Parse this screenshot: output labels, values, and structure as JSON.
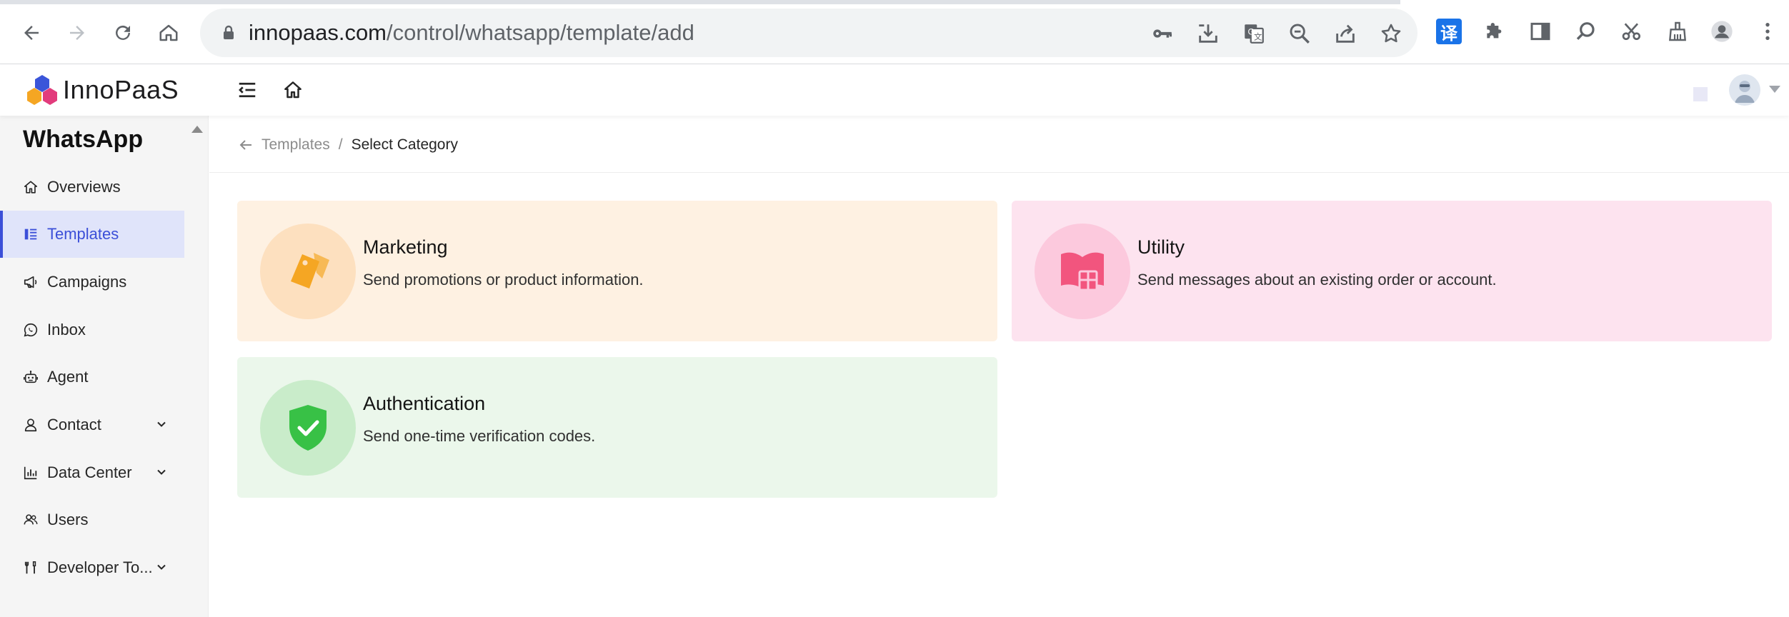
{
  "browser": {
    "url_host": "innopaas.com",
    "url_path": "/control/whatsapp/template/add",
    "translate_ext_label": "译"
  },
  "app": {
    "logo_text": "InnoPaaS"
  },
  "sidebar": {
    "title": "WhatsApp",
    "items": [
      {
        "label": "Overviews",
        "icon": "home-icon"
      },
      {
        "label": "Templates",
        "icon": "templates-icon"
      },
      {
        "label": "Campaigns",
        "icon": "megaphone-icon"
      },
      {
        "label": "Inbox",
        "icon": "chat-icon"
      },
      {
        "label": "Agent",
        "icon": "robot-icon"
      },
      {
        "label": "Contact",
        "icon": "user-icon"
      },
      {
        "label": "Data Center",
        "icon": "bar-chart-icon"
      },
      {
        "label": "Users",
        "icon": "users-icon"
      },
      {
        "label": "Developer To...",
        "icon": "tools-icon"
      }
    ]
  },
  "breadcrumb": {
    "parent": "Templates",
    "separator": "/",
    "current": "Select Category"
  },
  "categories": [
    {
      "title": "Marketing",
      "description": "Send promotions or product information.",
      "icon": "price-tag-icon",
      "bg": "#fef1e2",
      "circle": "#fde0bf",
      "accent": "#f5a623"
    },
    {
      "title": "Utility",
      "description": "Send messages about an existing order or account.",
      "icon": "book-icon",
      "bg": "#fde3ef",
      "circle": "#fcc9dd",
      "accent": "#f2557e"
    },
    {
      "title": "Authentication",
      "description": "Send one-time verification codes.",
      "icon": "shield-check-icon",
      "bg": "#ebf7eb",
      "circle": "#c9ecca",
      "accent": "#38c146"
    }
  ],
  "colors": {
    "primary": "#3b4fd8",
    "active_bg": "#e0e4fa"
  }
}
